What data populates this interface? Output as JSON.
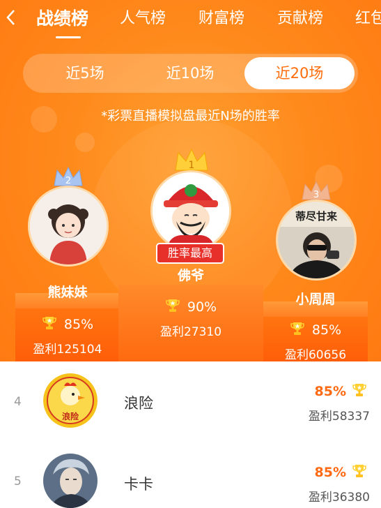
{
  "header": {
    "back_icon": "chevron-left-icon",
    "tabs": [
      {
        "label": "战绩榜",
        "active": true
      },
      {
        "label": "人气榜",
        "active": false
      },
      {
        "label": "财富榜",
        "active": false
      },
      {
        "label": "贡献榜",
        "active": false
      },
      {
        "label": "红包",
        "active": false
      }
    ]
  },
  "segments": [
    {
      "label": "近5场",
      "active": false
    },
    {
      "label": "近10场",
      "active": false
    },
    {
      "label": "近20场",
      "active": true
    }
  ],
  "subtitle": "*彩票直播模拟盘最近N场的胜率",
  "podium": {
    "first": {
      "rank": "1",
      "name": "佛爷",
      "rate": "90%",
      "profit": "盈利27310",
      "badge": "胜率最高"
    },
    "second": {
      "rank": "2",
      "name": "熊妹妹",
      "rate": "85%",
      "profit": "盈利125104"
    },
    "third": {
      "rank": "3",
      "name": "小周周",
      "rate": "85%",
      "profit": "盈利60656",
      "avatar_text": "蒂尽甘来"
    }
  },
  "list": [
    {
      "rank": "4",
      "name": "浪险",
      "rate": "85%",
      "profit": "盈利58337",
      "avatar_text": "浪险"
    },
    {
      "rank": "5",
      "name": "卡卡",
      "rate": "85%",
      "profit": "盈利36380"
    }
  ],
  "colors": {
    "accent": "#ff7a12",
    "badge": "#e8302a",
    "rate_text": "#ff6a13"
  }
}
